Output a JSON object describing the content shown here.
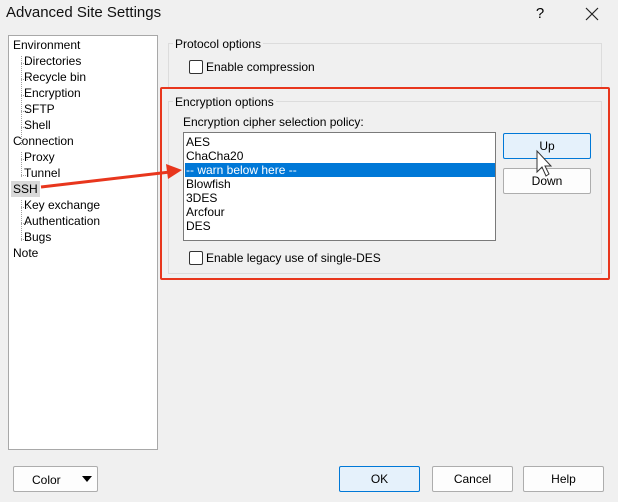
{
  "window": {
    "title": "Advanced Site Settings",
    "help_symbol": "?"
  },
  "tree": {
    "items": [
      {
        "label": "Environment",
        "level": 0
      },
      {
        "label": "Directories",
        "level": 1
      },
      {
        "label": "Recycle bin",
        "level": 1
      },
      {
        "label": "Encryption",
        "level": 1
      },
      {
        "label": "SFTP",
        "level": 1
      },
      {
        "label": "Shell",
        "level": 1
      },
      {
        "label": "Connection",
        "level": 0
      },
      {
        "label": "Proxy",
        "level": 1
      },
      {
        "label": "Tunnel",
        "level": 1
      },
      {
        "label": "SSH",
        "level": 0,
        "selected": true
      },
      {
        "label": "Key exchange",
        "level": 1
      },
      {
        "label": "Authentication",
        "level": 1
      },
      {
        "label": "Bugs",
        "level": 1
      },
      {
        "label": "Note",
        "level": 0
      }
    ]
  },
  "protocol": {
    "group_label": "Protocol options",
    "compression_label": "Enable compression",
    "compression_checked": false
  },
  "encryption": {
    "group_label": "Encryption options",
    "policy_label": "Encryption cipher selection policy:",
    "ciphers": [
      "AES",
      "ChaCha20",
      "-- warn below here --",
      "Blowfish",
      "3DES",
      "Arcfour",
      "DES"
    ],
    "selected_index": 2,
    "up_label": "Up",
    "down_label": "Down",
    "legacy_des_label": "Enable legacy use of single-DES",
    "legacy_des_checked": false
  },
  "footer": {
    "color_label": "Color",
    "ok_label": "OK",
    "cancel_label": "Cancel",
    "help_label": "Help"
  },
  "annotation_color": "#e8361d",
  "selection_color": "#0078d7"
}
